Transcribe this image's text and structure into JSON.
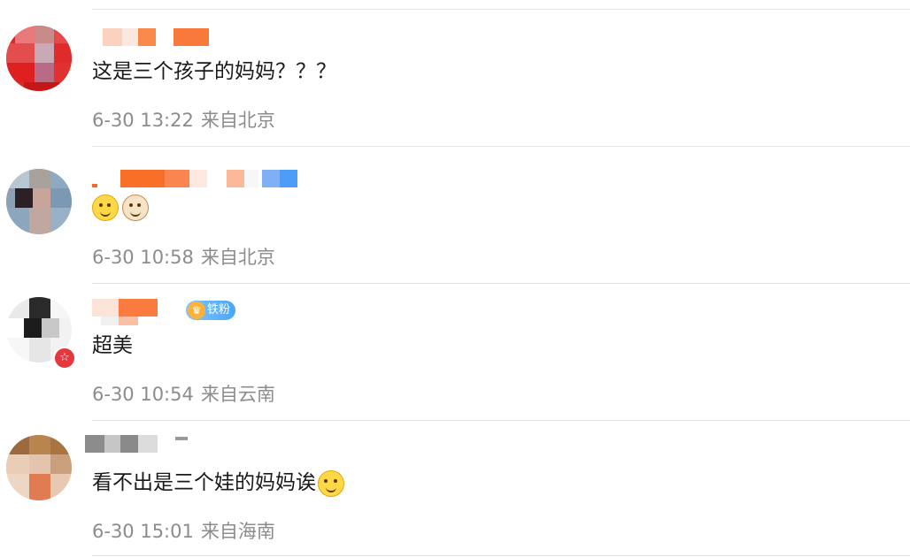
{
  "comments": [
    {
      "text": "这是三个孩子的妈妈？？？",
      "time": "6-30 13:22",
      "location": "来自北京",
      "emojis": []
    },
    {
      "text": "",
      "time": "6-30 10:58",
      "location": "来自北京",
      "emojis": [
        "thinking-emoji",
        "cat-emoji"
      ]
    },
    {
      "text": "超美",
      "time": "6-30 10:54",
      "location": "来自云南",
      "badge": "铁粉",
      "verified": true,
      "emojis": []
    },
    {
      "text": "看不出是三个娃的妈妈诶",
      "time": "6-30 15:01",
      "location": "来自海南",
      "emojis": [
        "laughing-crying-emoji"
      ]
    }
  ],
  "colors": {
    "divider": "#e3e3e3",
    "meta_text": "#8c8c8c",
    "body_text": "#1a1a1a",
    "fan_badge": "#4aa6f5",
    "verified_badge": "#e5373d"
  }
}
